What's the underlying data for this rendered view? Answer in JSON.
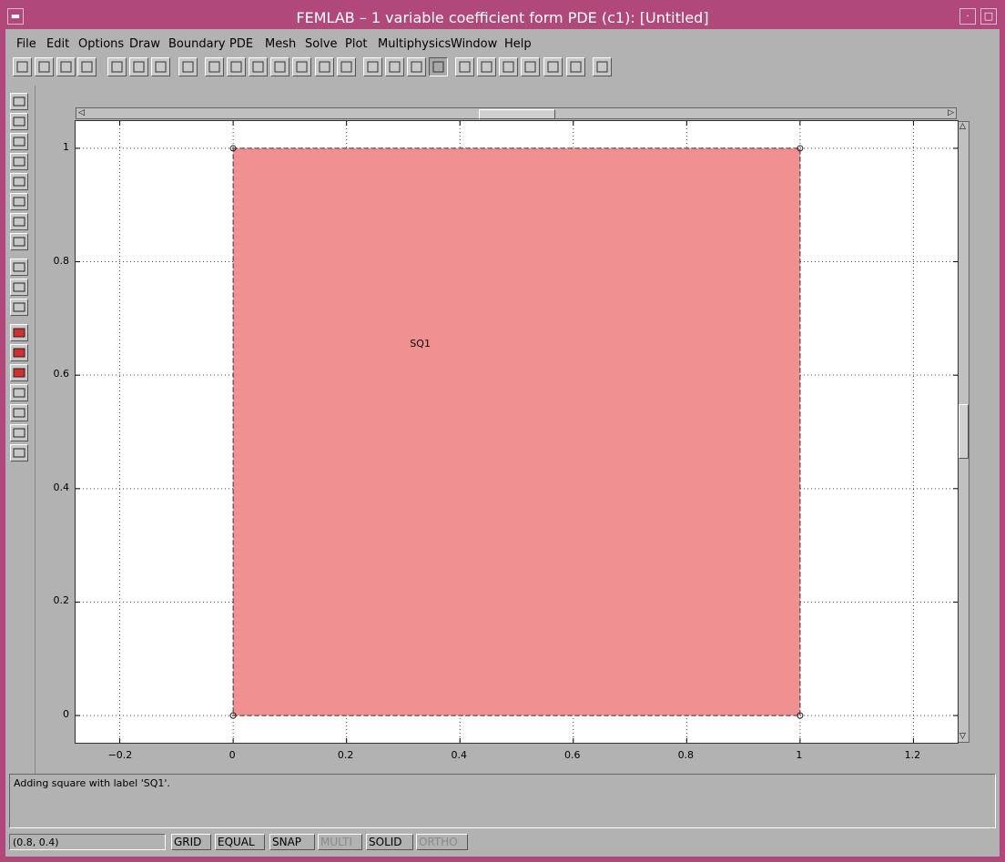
{
  "window": {
    "title": "FEMLAB – 1 variable coefficient form PDE (c1): [Untitled]"
  },
  "menu": [
    {
      "label": "File"
    },
    {
      "label": "Edit"
    },
    {
      "label": "Options"
    },
    {
      "label": "Draw"
    },
    {
      "label": "Boundary"
    },
    {
      "label": "PDE"
    },
    {
      "label": "Mesh"
    },
    {
      "label": "Solve"
    },
    {
      "label": "Plot"
    },
    {
      "label": "Multiphysics"
    },
    {
      "label": "Window"
    },
    {
      "label": "Help"
    }
  ],
  "toolbar_icons": [
    "new-file-icon",
    "open-icon",
    "save-icon",
    "print-icon",
    "cut-icon",
    "copy-icon",
    "paste-icon",
    "select-arrow-icon",
    "point-mode-icon",
    "boundary-mode-icon",
    "subdomain-mode-icon",
    "pde-spec-icon",
    "equals-icon",
    "mesh-icon",
    "refine-icon",
    "zoom-in-icon",
    "zoom-out-icon",
    "zoom-window-icon",
    "zoom-extents-icon",
    "edit-icon",
    "d-omega-icon",
    "omega-icon",
    "solve-icon",
    "sigma-icon",
    "plot-icon",
    "help-icon"
  ],
  "sidebar_icons": [
    "rectangle-icon",
    "rectangle-centered-icon",
    "ellipse-icon",
    "ellipse-centered-icon",
    "point-icon",
    "line-icon",
    "arc-icon",
    "curve-icon",
    "move-icon",
    "rotate-icon",
    "scale-icon",
    "union-icon",
    "intersection-icon",
    "difference-icon",
    "split-icon",
    "coerce-icon",
    "convert-icon",
    "draw-properties-icon"
  ],
  "plot": {
    "xticks": [
      "−0.2",
      "0",
      "0.2",
      "0.4",
      "0.6",
      "0.8",
      "1",
      "1.2"
    ],
    "yticks": [
      "0",
      "0.2",
      "0.4",
      "0.6",
      "0.8",
      "1"
    ],
    "xlim": [
      -0.278,
      1.278
    ],
    "ylim": [
      -0.048,
      1.048
    ],
    "shape": {
      "label": "SQ1",
      "x0": 0,
      "y0": 0,
      "x1": 1,
      "y1": 1,
      "fill": "#f09090"
    }
  },
  "message": "Adding square with label 'SQ1'.",
  "status": {
    "coords": "(0.8, 0.4)",
    "toggles": [
      {
        "label": "GRID",
        "enabled": true
      },
      {
        "label": "EQUAL",
        "enabled": true
      },
      {
        "label": "SNAP",
        "enabled": true
      },
      {
        "label": "MULTI",
        "enabled": false
      },
      {
        "label": "SOLID",
        "enabled": true
      },
      {
        "label": "ORTHO",
        "enabled": false
      }
    ]
  }
}
